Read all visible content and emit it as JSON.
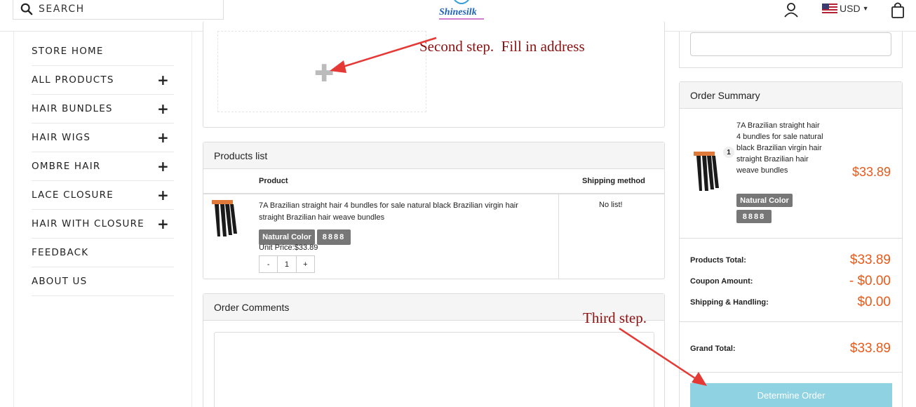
{
  "header": {
    "search_label": "SEARCH",
    "currency": "USD"
  },
  "sidebar": {
    "items": [
      {
        "label": "STORE HOME",
        "expandable": false
      },
      {
        "label": "ALL PRODUCTS",
        "expandable": true
      },
      {
        "label": "HAIR BUNDLES",
        "expandable": true
      },
      {
        "label": "HAIR WIGS",
        "expandable": true
      },
      {
        "label": "OMBRE HAIR",
        "expandable": true
      },
      {
        "label": "LACE CLOSURE",
        "expandable": true
      },
      {
        "label": "HAIR WITH CLOSURE",
        "expandable": true
      },
      {
        "label": "FEEDBACK",
        "expandable": false
      },
      {
        "label": "ABOUT US",
        "expandable": false
      }
    ],
    "plus_glyph": "+"
  },
  "products": {
    "title": "Products list",
    "col_product": "Product",
    "col_shipping": "Shipping method",
    "item": {
      "name": "7A Brazilian straight hair 4 bundles for sale natural black Brazilian virgin hair straight Brazilian hair weave bundles",
      "color_tag": "Natural Color",
      "size_tag": "8888",
      "unit_price": "Unit Price:$33.89",
      "qty": "1",
      "minus": "-",
      "plus": "+",
      "shipping": "No list!"
    }
  },
  "comments": {
    "title": "Order Comments"
  },
  "summary": {
    "title": "Order Summary",
    "item_name": "7A Brazilian straight hair 4 bundles for sale natural black Brazilian virgin hair straight Brazilian hair weave bundles",
    "qty": "1",
    "price": "$33.89",
    "color_tag": "Natural Color",
    "size_tag": "8888",
    "products_total_label": "Products Total:",
    "products_total": "$33.89",
    "coupon_label": "Coupon Amount:",
    "coupon": "- $0.00",
    "shipping_label": "Shipping & Handling:",
    "shipping": "$0.00",
    "grand_total_label": "Grand Total:",
    "grand_total": "$33.89",
    "determine_button": "Determine Order"
  },
  "annotations": {
    "second_step": "Second step.  Fill in address",
    "third_step": "Third step."
  },
  "colors": {
    "price": "#e8591a",
    "annotation": "#8b1010",
    "arrow": "#e53935",
    "button": "#8fd3e3"
  }
}
